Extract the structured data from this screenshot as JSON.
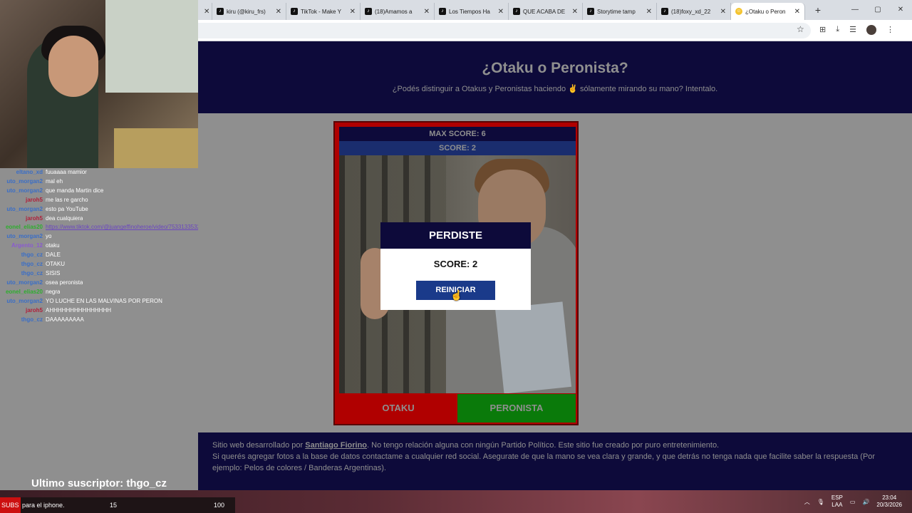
{
  "browser": {
    "tabs": [
      {
        "label": "",
        "icon": "close-icon"
      },
      {
        "label": "kiru (@kiru_frs)",
        "icon": "tiktok-icon"
      },
      {
        "label": "TikTok - Make Y",
        "icon": "tiktok-icon"
      },
      {
        "label": "(18)Amamos a",
        "icon": "tiktok-icon"
      },
      {
        "label": "Los Tiempos Ha",
        "icon": "tiktok-icon"
      },
      {
        "label": "QUE ACABA DE",
        "icon": "tiktok-icon"
      },
      {
        "label": "Storytime tamp",
        "icon": "tiktok-icon"
      },
      {
        "label": "(18)foxy_xd_22",
        "icon": "tiktok-icon"
      },
      {
        "label": "¿Otaku o Peron",
        "icon": "emoji-icon"
      }
    ],
    "new_tab": "+",
    "min": "—",
    "max": "▢",
    "close": "✕"
  },
  "header": {
    "title": "¿Otaku o Peronista?",
    "subtitle": "¿Podés distinguir a Otakus y Peronistas haciendo ✌ sólamente mirando su mano? Intentalo."
  },
  "game": {
    "max_score": "MAX SCORE: 6",
    "score": "SCORE: 2",
    "btn_otaku": "OTAKU",
    "btn_peronista": "PERONISTA"
  },
  "modal": {
    "title": "PERDISTE",
    "score": "SCORE: 2",
    "restart": "REINICIAR"
  },
  "footer": {
    "prefix": "Sitio web desarrollado por ",
    "author": "Santiago Fiorino",
    "suffix": ". No tengo relación alguna con ningún Partido Político. Este sitio fue creado por puro entretenimiento.",
    "line2": "Si querés agregar fotos a la base de datos contactame a cualquier red social. Asegurate de que la mano se vea clara y grande, y que detrás no tenga nada que facilite saber la respuesta (Por ejemplo: Pelos de colores / Banderas Argentinas)."
  },
  "chat": [
    {
      "user": "eltano_xd",
      "msg": "fuuaaaa mamior",
      "color": "#3a6ec7"
    },
    {
      "user": "uto_morgan2",
      "msg": "mal eh",
      "color": "#3a6ec7"
    },
    {
      "user": "uto_morgan2",
      "msg": "que manda Martin dice",
      "color": "#3a6ec7"
    },
    {
      "user": "jaroh5",
      "msg": "me las re garcho",
      "color": "#b0203a"
    },
    {
      "user": "uto_morgan2",
      "msg": "esto pa YouTube",
      "color": "#3a6ec7"
    },
    {
      "user": "jaroh5",
      "msg": "dea cualquiera",
      "color": "#b0203a"
    },
    {
      "user": "eonel_elias20",
      "msg": "https://www.tiktok.com/@juangeffinoheroe/video/7533133532673740547",
      "color": "#2fae2f",
      "link": true
    },
    {
      "user": "uto_morgan2",
      "msg": "yo",
      "color": "#3a6ec7"
    },
    {
      "user": "Argento_12",
      "msg": "otaku",
      "color": "#8a5ad0"
    },
    {
      "user": "thgo_cz",
      "msg": "DALE",
      "color": "#3a6ec7"
    },
    {
      "user": "thgo_cz",
      "msg": "OTAKU",
      "color": "#3a6ec7"
    },
    {
      "user": "thgo_cz",
      "msg": "SISIS",
      "color": "#3a6ec7"
    },
    {
      "user": "uto_morgan2",
      "msg": "osea peronista",
      "color": "#3a6ec7"
    },
    {
      "user": "eonel_elias20",
      "msg": "negra",
      "color": "#2fae2f"
    },
    {
      "user": "uto_morgan2",
      "msg": "YO LUCHE EN LAS MALVINAS POR PERON",
      "color": "#3a6ec7"
    },
    {
      "user": "jaroh5",
      "msg": "AHHHHHHHHHHHHHHH",
      "color": "#b0203a"
    },
    {
      "user": "thgo_cz",
      "msg": "DAAAAAAAAA",
      "color": "#3a6ec7"
    }
  ],
  "overlay": {
    "last_sub": "Ultimo suscriptor: thgo_cz",
    "ticker_red": "SUBS",
    "ticker_text": " para el iphone.",
    "ticker_a": "15",
    "ticker_b": "100"
  },
  "tray": {
    "lang1": "ESP",
    "lang2": "LAA",
    "time": "23:04",
    "date": "20/3/2026"
  }
}
